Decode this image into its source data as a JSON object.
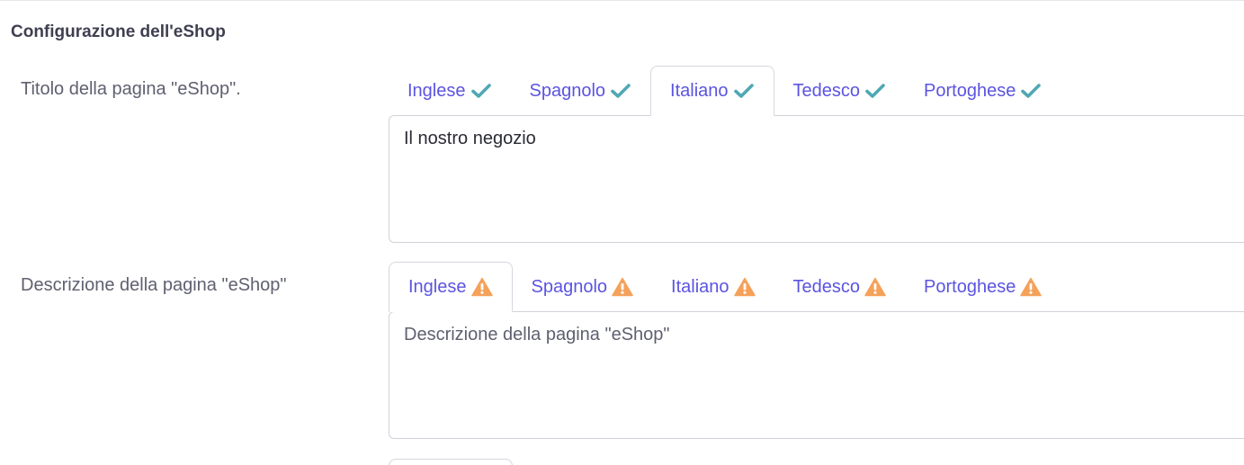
{
  "section": {
    "title": "Configurazione dell'eShop"
  },
  "title_field": {
    "label": "Titolo della pagina \"eShop\".",
    "tabs": [
      {
        "label": "Inglese",
        "status_icon": "check-icon"
      },
      {
        "label": "Spagnolo",
        "status_icon": "check-icon"
      },
      {
        "label": "Italiano",
        "status_icon": "check-icon",
        "active": true
      },
      {
        "label": "Tedesco",
        "status_icon": "check-icon"
      },
      {
        "label": "Portoghese",
        "status_icon": "check-icon"
      }
    ],
    "value": "Il nostro negozio"
  },
  "description_field": {
    "label": "Descrizione della pagina \"eShop\"",
    "tabs": [
      {
        "label": "Inglese",
        "status_icon": "warning-icon",
        "active": true
      },
      {
        "label": "Spagnolo",
        "status_icon": "warning-icon"
      },
      {
        "label": "Italiano",
        "status_icon": "warning-icon"
      },
      {
        "label": "Tedesco",
        "status_icon": "warning-icon"
      },
      {
        "label": "Portoghese",
        "status_icon": "warning-icon"
      }
    ],
    "placeholder": "Descrizione della pagina \"eShop\""
  },
  "colors": {
    "tab_text": "#5b54e0",
    "check": "#4fa8b4",
    "warning": "#f5a15a",
    "label": "#5f6070",
    "title": "#3f3f51"
  }
}
